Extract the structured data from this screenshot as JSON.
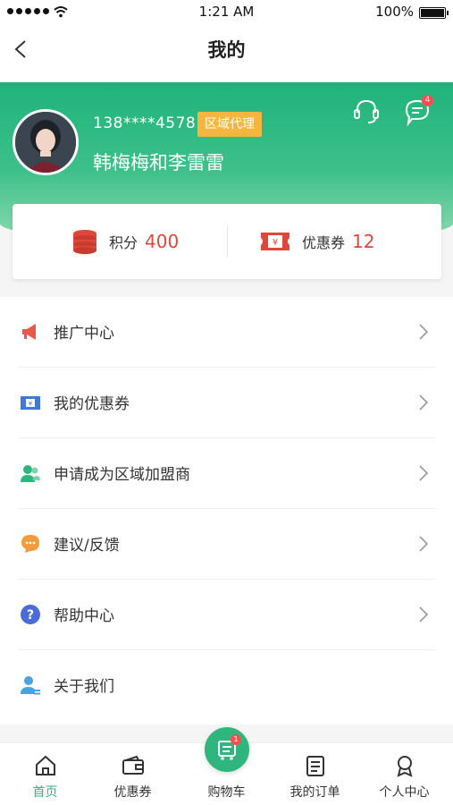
{
  "status_bar": {
    "time": "1:21 AM",
    "battery": "100%"
  },
  "nav": {
    "title": "我的"
  },
  "profile": {
    "phone": "138****4578",
    "badge": "区域代理",
    "name": "韩梅梅和李雷雷",
    "message_count": "4"
  },
  "stats": {
    "points_label": "积分",
    "points_value": "400",
    "coupons_label": "优惠券",
    "coupons_value": "12"
  },
  "menu": [
    {
      "label": "推广中心",
      "icon": "megaphone-icon"
    },
    {
      "label": "我的优惠券",
      "icon": "coupon-icon"
    },
    {
      "label": "申请成为区域加盟商",
      "icon": "users-icon"
    },
    {
      "label": "建议/反馈",
      "icon": "feedback-icon"
    },
    {
      "label": "帮助中心",
      "icon": "help-icon"
    },
    {
      "label": "关于我们",
      "icon": "about-icon"
    }
  ],
  "tabbar": {
    "home": "首页",
    "coupons": "优惠券",
    "cart": "购物车",
    "cart_count": "1",
    "orders": "我的订单",
    "profile": "个人中心"
  },
  "colors": {
    "primary": "#2fb57e",
    "accent_red": "#e0473b",
    "badge_orange": "#f4b63e"
  }
}
